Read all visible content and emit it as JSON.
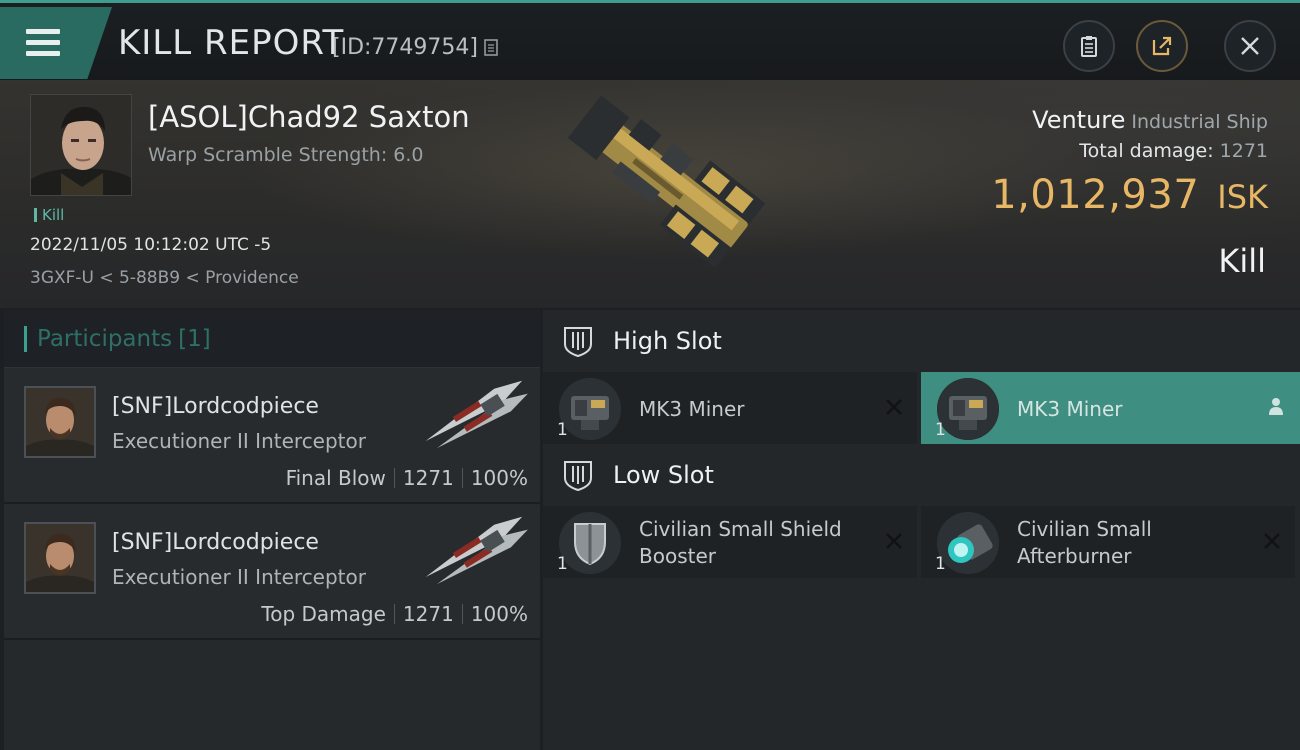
{
  "header": {
    "title": "KILL REPORT",
    "report_id": "[ID:7749754]"
  },
  "victim": {
    "name": "[ASOL]Chad92 Saxton",
    "warp_scramble": "Warp Scramble Strength: 6.0",
    "tag": "Kill",
    "datetime": "2022/11/05 10:12:02 UTC -5",
    "location": "3GXF-U < 5-88B9 < Providence",
    "ship_name": "Venture",
    "ship_class": "Industrial Ship",
    "total_damage_label": "Total damage:",
    "total_damage_value": "1271",
    "isk_value": "1,012,937",
    "isk_unit": "ISK",
    "result": "Kill"
  },
  "participants": {
    "label": "Participants",
    "count": "[1]",
    "rows": [
      {
        "name": "[SNF]Lordcodpiece",
        "ship": "Executioner II Interceptor",
        "role": "Final Blow",
        "damage": "1271",
        "percent": "100%"
      },
      {
        "name": "[SNF]Lordcodpiece",
        "ship": "Executioner II Interceptor",
        "role": "Top Damage",
        "damage": "1271",
        "percent": "100%"
      }
    ]
  },
  "fitting": {
    "high_slot": {
      "title": "High Slot",
      "modules": [
        {
          "name": "MK3 Miner",
          "qty": "1"
        },
        {
          "name": "MK3 Miner",
          "qty": "1"
        }
      ]
    },
    "low_slot": {
      "title": "Low Slot",
      "modules": [
        {
          "name": "Civilian Small Shield Booster",
          "qty": "1"
        },
        {
          "name": "Civilian Small Afterburner",
          "qty": "1"
        }
      ]
    }
  },
  "colors": {
    "accent": "#3e9d8c",
    "isk": "#e8b765",
    "active_module": "#3e8e82"
  }
}
